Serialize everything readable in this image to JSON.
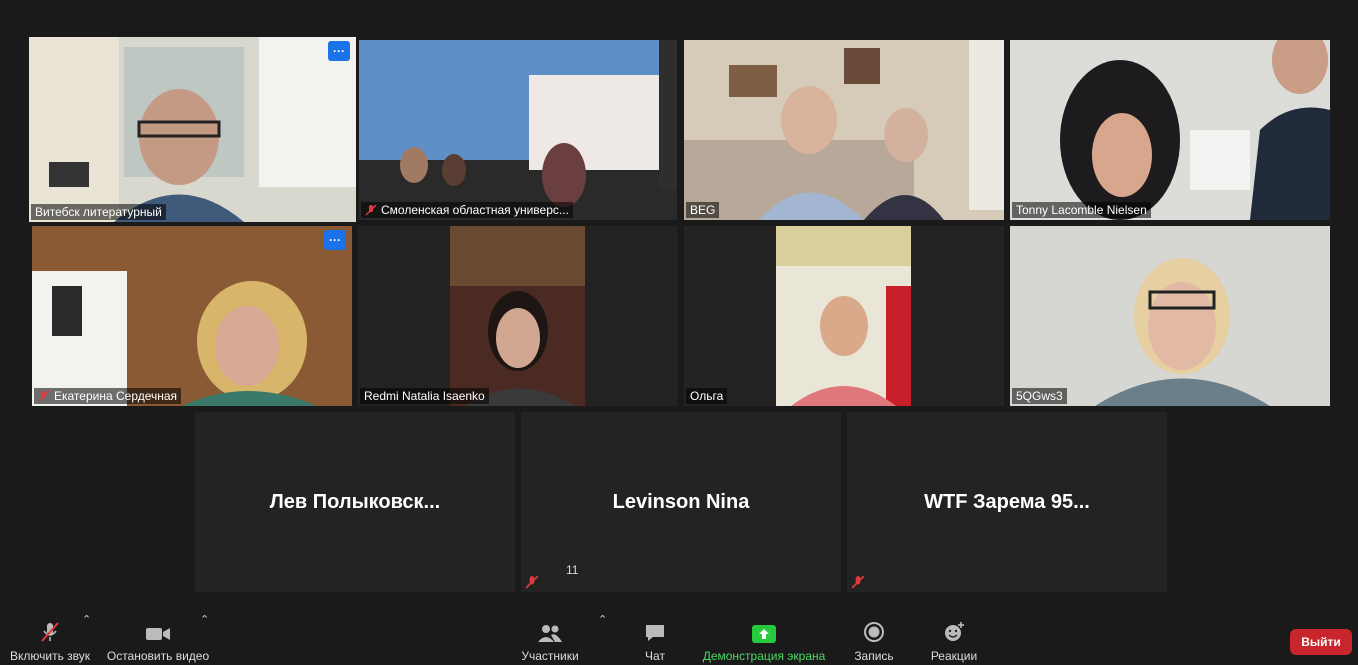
{
  "tiles": [
    {
      "name": "Витебск литературный",
      "muted": false,
      "active": true,
      "more": "···"
    },
    {
      "name": "Смоленская областная универс...",
      "muted": true
    },
    {
      "name": "BEG",
      "muted": false
    },
    {
      "name": "Tonny Lacomble Nielsen",
      "muted": false
    },
    {
      "name": "Екатерина Сердечная",
      "muted": true,
      "more": "···"
    },
    {
      "name": "Redmi Natalia Isaenko",
      "muted": false
    },
    {
      "name": "Ольга",
      "muted": false
    },
    {
      "name": "5QGws3",
      "muted": false
    }
  ],
  "name_tiles": [
    {
      "label": "Лев  Полыковск...",
      "muted": false
    },
    {
      "label": "Levinson Nina",
      "muted": true
    },
    {
      "label": "WTF Зарема 95...",
      "muted": true
    }
  ],
  "toolbar": {
    "unmute": "Включить звук",
    "stop_video": "Остановить видео",
    "participants": "Участники",
    "participants_count": "11",
    "chat": "Чат",
    "share": "Демонстрация экрана",
    "record": "Запись",
    "reactions": "Реакции",
    "leave": "Выйти"
  },
  "colors": {
    "active_border": "#a6d84a",
    "share_green": "#4cd964",
    "leave_red": "#c9252d",
    "more_blue": "#1a73e8"
  }
}
